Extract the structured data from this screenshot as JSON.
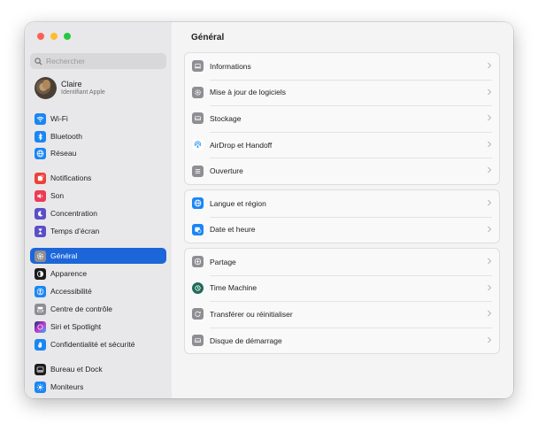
{
  "window": {
    "title": "Général"
  },
  "search": {
    "placeholder": "Rechercher"
  },
  "account": {
    "name": "Claire",
    "subtitle": "Identifiant Apple"
  },
  "sidebar": {
    "items": [
      {
        "label": "Wi-Fi",
        "icon": "wifi-icon",
        "color": "#1a86f5"
      },
      {
        "label": "Bluetooth",
        "icon": "bluetooth-icon",
        "color": "#1a86f5"
      },
      {
        "label": "Réseau",
        "icon": "globe-icon",
        "color": "#1a86f5"
      },
      {
        "label": "Notifications",
        "icon": "bell-icon",
        "color": "#ef4038"
      },
      {
        "label": "Son",
        "icon": "speaker-icon",
        "color": "#ef3a54"
      },
      {
        "label": "Concentration",
        "icon": "moon-icon",
        "color": "#5b4ec8"
      },
      {
        "label": "Temps d’écran",
        "icon": "hourglass-icon",
        "color": "#5b4ec8"
      },
      {
        "label": "Général",
        "icon": "gear-icon",
        "color": "#8e8e93",
        "active": true
      },
      {
        "label": "Apparence",
        "icon": "appearance-icon",
        "color": "#1c1c1e"
      },
      {
        "label": "Accessibilité",
        "icon": "accessibility-icon",
        "color": "#1a86f5"
      },
      {
        "label": "Centre de contrôle",
        "icon": "control-center-icon",
        "color": "#8e8e93"
      },
      {
        "label": "Siri et Spotlight",
        "icon": "siri-icon",
        "color": "#c23bd6"
      },
      {
        "label": "Confidentialité et sécurité",
        "icon": "hand-icon",
        "color": "#1a86f5"
      },
      {
        "label": "Bureau et Dock",
        "icon": "dock-icon",
        "color": "#1c1c1e"
      },
      {
        "label": "Moniteurs",
        "icon": "sun-icon",
        "color": "#1a86f5"
      }
    ]
  },
  "main": {
    "groups": [
      [
        {
          "label": "Informations",
          "icon": "laptop-icon",
          "color": "#8e8e93"
        },
        {
          "label": "Mise à jour de logiciels",
          "icon": "gear-badge-icon",
          "color": "#8e8e93"
        },
        {
          "label": "Stockage",
          "icon": "drive-icon",
          "color": "#8e8e93"
        },
        {
          "label": "AirDrop et Handoff",
          "icon": "airdrop-icon",
          "color": "#1a86f5"
        },
        {
          "label": "Ouverture",
          "icon": "login-items-icon",
          "color": "#8e8e93"
        }
      ],
      [
        {
          "label": "Langue et région",
          "icon": "globe-icon",
          "color": "#1a86f5"
        },
        {
          "label": "Date et heure",
          "icon": "calendar-clock-icon",
          "color": "#1a86f5"
        }
      ],
      [
        {
          "label": "Partage",
          "icon": "sharing-icon",
          "color": "#8e8e93"
        },
        {
          "label": "Time Machine",
          "icon": "time-machine-icon",
          "color": "#1f6b5a"
        },
        {
          "label": "Transférer ou réinitialiser",
          "icon": "reset-icon",
          "color": "#8e8e93"
        },
        {
          "label": "Disque de démarrage",
          "icon": "startup-disk-icon",
          "color": "#8e8e93"
        }
      ]
    ]
  }
}
